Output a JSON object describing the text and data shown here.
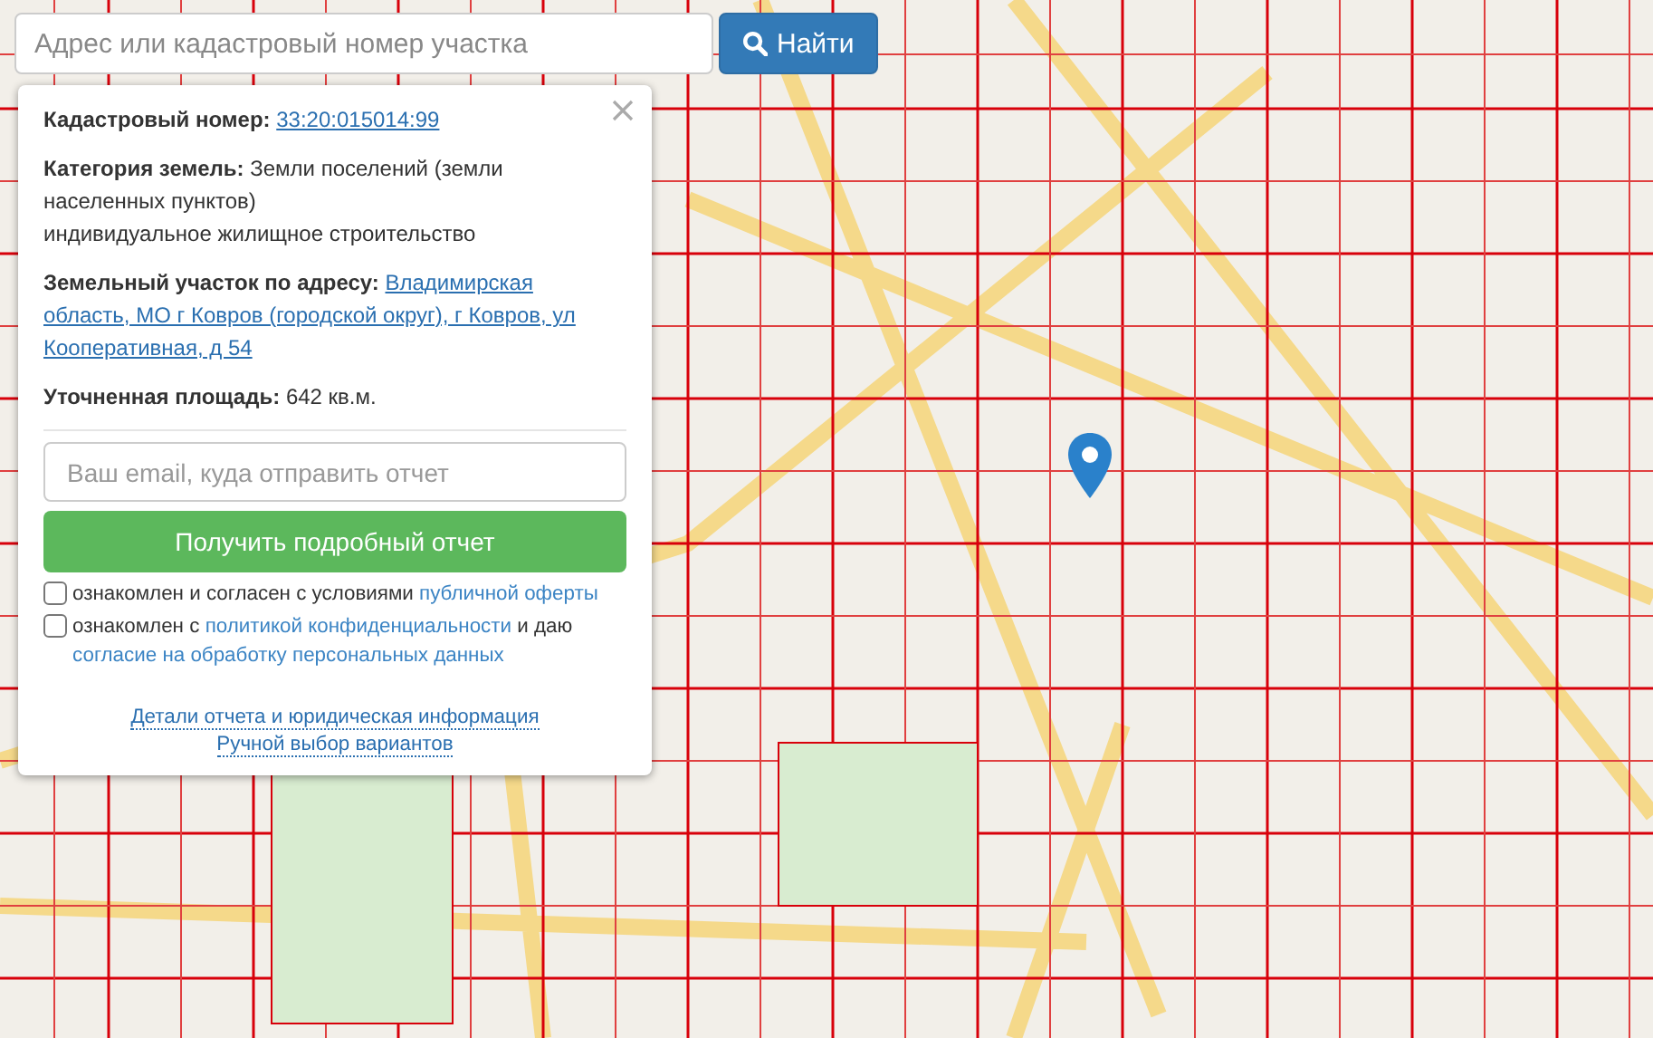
{
  "search": {
    "placeholder": "Адрес или кадастровый номер участка",
    "button": "Найти"
  },
  "info_panel": {
    "fields": [
      {
        "label": "Кадастровый номер:",
        "kind": "link",
        "lines": [
          "33:20:015014:99"
        ]
      },
      {
        "label": "Категория земель:",
        "kind": "text",
        "lines": [
          "Земли поселений (земли",
          "населенных пунктов)",
          "индивидуальное жилищное строительство"
        ]
      },
      {
        "label": "Земельный участок по адресу:",
        "kind": "link",
        "lines": [
          "Владимирская",
          "область, МО г Ковров (городской округ), г Ковров, ул",
          "Кооперативная, д 54"
        ]
      },
      {
        "label": "Уточненная площадь:",
        "kind": "text",
        "lines": [
          "642 кв.м."
        ]
      }
    ],
    "email": {
      "placeholder": "Ваш email, куда отправить отчет"
    },
    "submit_button": "Получить подробный отчет",
    "consents": [
      {
        "checked": false,
        "parts": [
          {
            "text": "ознакомлен и согласен с условиями ",
            "link": false
          },
          {
            "text": "публичной оферты",
            "link": true
          }
        ]
      },
      {
        "checked": false,
        "parts": [
          {
            "text": "ознакомлен с ",
            "link": false
          },
          {
            "text": "политикой конфиденциальности",
            "link": true
          },
          {
            "text": " и даю ",
            "link": false
          },
          {
            "text": "согласие на обработку персональных данных",
            "link": true
          }
        ]
      }
    ],
    "footer_links": [
      "Детали отчета и юридическая информация",
      "Ручной выбор вариантов"
    ]
  }
}
